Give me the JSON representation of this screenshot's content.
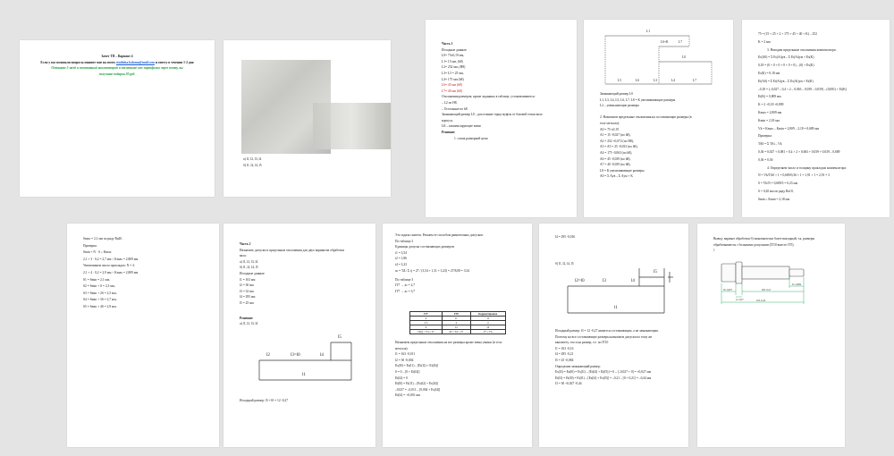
{
  "pages": [
    {
      "title": "Зачет ТП – Вариант 4",
      "line1_pre": "Если у вас возникли вопросы пишите мне на почту",
      "email": "studioka.kalama@mail.com",
      "line1_post": "и ответу в течении 1-2 дня",
      "green": [
        "Оставьте 5 звезд и позитивный комментарий и отметьте мое портфолио через почту, вы",
        "получите подарок 20 руб."
      ]
    },
    {
      "lines": [
        "а) l1, l2, l3, l4",
        "б) l1, l2, l4, l5"
      ]
    },
    {
      "heading": "Часть 1",
      "lines": [
        "Исходные данные:",
        "L0= 75±0,19 мм,",
        "L1= 15 мм, (h8)",
        "L2= 252 мм, (H8)",
        "L3= L5 = 25 мм,",
        "L4= 175 мм (h8)",
        "L6= 45 мм (h8)",
        "L7= 40 мм (h8)",
        "Отклонения размеров, кроме заданных в таблице, установливаются:",
        "– L2 по H8,",
        "– Остальные по h8.",
        "Замыкающий размер L0 – расстояние торца муфты от базовой точки вала",
        "корпуса.",
        "LК – компенсирующее звено"
      ],
      "solution": "Решение:",
      "item": "1.   схема размерной цепи"
    },
    {
      "dims": [
        "L1",
        "L6+К",
        "L7",
        "L0",
        "L5",
        "L6",
        "L3",
        "L4",
        "L2",
        "L7"
      ],
      "lines": [
        "Замыкающий размер L0",
        "L1, L3, L4, L5, L6, L7, L8 = К увеличивающие размеры",
        "L2 – уменьшающие размеры",
        "",
        "2. Назначаем предельные отклонения на составляющие размеры (в",
        "  теле металла):",
        "A0 = 75 ±0,19",
        "A1 = 15 -0,027   (по h8),",
        "A2 = 252 +0,072   (по H8),",
        "A3 = A5 = 25 -0,033   (по h8),",
        "A4 = 175 -0,063   (по h8),",
        "A6 = 45 -0,039   (по h8),",
        "A7 = 40 -0,039   (по h8),",
        "L8 = К увеличивающие размеры",
        "A0 = Σ Aув – Σ Aум + K"
      ]
    },
    {
      "lines": [
        "75 = (15 + 25 × 2 + 175 + 45 + 40 + K) – 252",
        "K = 2 мм",
        "3. Находим предельные отклонения компенсатора:",
        "Es(A0) = Σ Es(Ai)ув – Σ Ei(Ai)ум + Es(K)",
        "0,18 = (0 + 0 + 0 + 0 + 0 + 0) – (0) + Es(K)",
        "Es(K) = 0,18 мм",
        "Ei(A0) = Σ Ei(Ai)ув – Σ Es(Ai)ум + Ei(K)",
        "–0,18 = (–0,027 – 0,4 × 2 – 0,063 – 0,039 – 0,039) – (0,081) + Ei(K)",
        "Ei(K) = 0,809 мм",
        "K = 2 +0,18 +0,809",
        "Kmax = 2,809 мм",
        "Kmin = 2,18 мм",
        "Vk = Kmax – Kmin = 2,809 – 2,18 = 0,689 мм",
        "Проверка:",
        "TA0 = Σ TAi – Vk",
        "0,36 = 0,027 + 0,081 + 0,4 × 2 + 0,063 + 0,039 + 0,039 – 0,689",
        "0,36 = 0,36",
        "4. Определяем число и толщину прокладок компенсатора:",
        "N = Vk/TA0 + 1 = 0,689/0,36 + 1 = 1,91 + 1 = 2,91 = 3",
        "S = Vk/N = 0,689/3 = 0,23 мм",
        "S = 0,20 мм по ряду Ra10,",
        "Smin ≤ Kmin = 2,18 мм"
      ]
    },
    {
      "lines": [
        "Smax = 2,1 мм по ряду Ra40.",
        "Проверка:",
        "Smin + N · S ≥ Kmax",
        "2,1 + 3 · 0,2 = 2,7 мм < Kmax = 2,809 мм",
        "Увеличиваем число прокладок: N = 4.",
        "2,1 + 4 · 0,2 = 2,9 мм > Kmax = 2,809 мм",
        "S1 = Smin = 2,1 мм,",
        "S2 = Smin + S = 2,3 мм,",
        "S3 = Smin + 2S = 2,5 мм,",
        "S4 = Smin + 3S = 2,7 мм,",
        "S5 = Smin + 4S = 2,9 мм."
      ]
    },
    {
      "heading": "Часть 2",
      "lines": [
        "Назначить допуски и предельные отклонения для двух вариантов обработки",
        "вала:",
        "а) l1, l2, l3, l4",
        "б) l1, l2, l4, l5",
        "Исходные данные:",
        "l1 = 163 мм",
        "l2 = 30 мм",
        "l3 = 32 мм",
        "l4 = 295 мм",
        "l5 = 25 мм"
      ],
      "solution": "Решение:",
      "item": "а) l1, l2, l3, l4",
      "dims": [
        "l5",
        "l2",
        "l3=l0",
        "l4",
        "l1"
      ],
      "bottom": "Исходный размер: l3 = l0 = 12 -0,27"
    },
    {
      "lines": [
        "Это задача синтеза. Решаем ее способом равноточных допусков.",
        "По таблице 2",
        "Единицы допуска составляющих размеров:",
        "i1 = 3,54",
        "i2 = 1,86",
        "i4 = 3,23",
        "ac = TΔ / Σ ij = 27 / (3,54 + 1,31 + 3,23) = 27/8,08 = 3,34",
        "По таблице 3",
        "IT7 → ac = 2,7",
        "IT7 → ac = 3,7"
      ],
      "table_headers": [
        "IT7",
        "IT8",
        "Корректировка"
      ],
      "table_rows": [
        [
          "9",
          "11",
          "11"
        ],
        [
          "2,5",
          "4",
          "4"
        ],
        [
          "9",
          "12",
          "10"
        ],
        [
          "10(l) ≈ TΔ = 27",
          "26 ≈ TΔ = 27",
          "27 = TΔ"
        ]
      ],
      "lines2": [
        "Назначаем предельные отклонения на все размеры кроме звена увязки (в тело",
        "металла):",
        "l1 = 163 -0,011",
        "l2 = 30 -0,004",
        "Es(l0) = Es(l1) – [Ei(l2) + Ei(l4)]",
        "0 = 0 – [0 + Ei(l4)]",
        "Ei(l4) = 0",
        "Ei(l0) = Ei(l1) – [Es(l2) + Es(l4)]",
        "–0,027 = –0,011 – [0,004 + Es(l4)]",
        "Ei(l4) = +0,001 мм"
      ]
    },
    {
      "top": "l4 = 295 -0,016",
      "item": "б) l1, l2, l4, l5",
      "dims": [
        "l5",
        "l2=l0",
        "l3",
        "l4",
        "l1"
      ],
      "lines": [
        "Исходный размер: l3 = 12 -0,27 является составляющим, а не замыкающим.",
        "Поэтому на все составляющие размеры назначаем допуски по тому же",
        "квалитету, что и на размер, т.е. по IT10",
        "l1 = 163 -0,16",
        "l4 = 295 -0,21",
        "l5 = 25 -0,084",
        "Определим замыкающий размер:",
        "Es(l3) = Es(l0) = Es(l1) – [Ei(l4) + Ei(l5)] = 0 – [–0,027 + 0] = +0,027 мм",
        "Ei(l3) = Ei(l0) = Ei(l1) – [Es(l4) + Es(l5)] = –0,21 – [0 + 0,21] = –0,44 мм",
        "l3 = 30 +0,027 -0,44"
      ]
    },
    {
      "lines": [
        "Вывод: вариант обработки б) экономически более выгодный, т.к. размеры",
        "обрабатываются с большими допусками (IT10 вместо IT5)."
      ],
      "dims": [
        "30 -0,027",
        "12 -0,27",
        "295 -0,21",
        "25 -0,084",
        "163 -0,16"
      ]
    }
  ],
  "colors": {
    "background": "#e4e4e4",
    "link": "#1f5fd6",
    "green": "#1a9a3a",
    "red": "#d01010",
    "dim_green": "#3cb371"
  }
}
